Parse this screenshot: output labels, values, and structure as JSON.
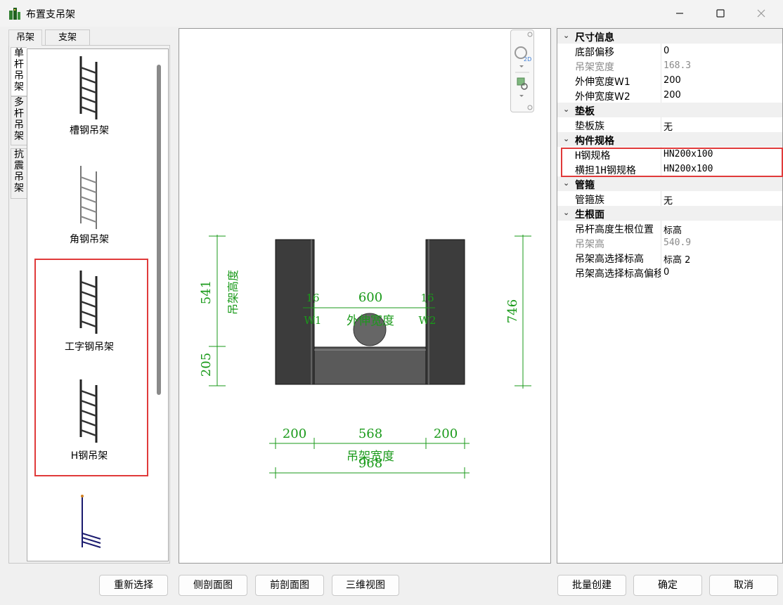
{
  "window": {
    "title": "布置支吊架",
    "icon": "building-icon",
    "controls": [
      "minimize-icon",
      "maximize-icon",
      "close-icon"
    ]
  },
  "left_tabs": {
    "top": [
      {
        "label": "吊架",
        "active": true
      },
      {
        "label": "支架",
        "active": false
      }
    ],
    "side": [
      {
        "label": "单杆吊架",
        "active": true
      },
      {
        "label": "多杆吊架",
        "active": false
      },
      {
        "label": "抗震吊架",
        "active": false
      }
    ]
  },
  "hanger_list": [
    {
      "label": "槽钢吊架",
      "icon": "channel-steel-hanger-icon"
    },
    {
      "label": "角钢吊架",
      "icon": "angle-steel-hanger-icon"
    },
    {
      "label": "工字钢吊架",
      "icon": "i-beam-hanger-icon"
    },
    {
      "label": "H钢吊架",
      "icon": "h-steel-hanger-icon"
    },
    {
      "label": "",
      "icon": "cantilever-hanger-icon"
    }
  ],
  "preview": {
    "dims": {
      "left_upper": "541",
      "left_upper_label": "吊架高度",
      "left_lower": "205",
      "right_height": "746",
      "top_left_flange": "16",
      "top_right_flange": "16",
      "top_mid": "600",
      "w1": "W1",
      "w2": "W2",
      "mid_label": "外伸宽度",
      "bottom_left": "200",
      "bottom_mid": "568",
      "bottom_right": "200",
      "bottom_label": "吊架宽度",
      "bottom_total": "968"
    },
    "toolbar": [
      "2d-view-icon",
      "zoom-region-icon"
    ]
  },
  "properties": {
    "categories": [
      {
        "name": "尺寸信息",
        "rows": [
          {
            "name": "底部偏移",
            "value": "0",
            "readonly": false
          },
          {
            "name": "吊架宽度",
            "value": "168.3",
            "readonly": true
          },
          {
            "name": "外伸宽度W1",
            "value": "200",
            "readonly": false
          },
          {
            "name": "外伸宽度W2",
            "value": "200",
            "readonly": false
          }
        ]
      },
      {
        "name": "垫板",
        "rows": [
          {
            "name": "垫板族",
            "value": "无",
            "readonly": false
          }
        ]
      },
      {
        "name": "构件规格",
        "rows": [
          {
            "name": "H钢规格",
            "value": "HN200x100",
            "readonly": false
          },
          {
            "name": "横担1H钢规格",
            "value": "HN200x100",
            "readonly": false
          }
        ]
      },
      {
        "name": "管箍",
        "rows": [
          {
            "name": "管箍族",
            "value": "无",
            "readonly": false
          }
        ]
      },
      {
        "name": "生根面",
        "rows": [
          {
            "name": "吊杆高度生根位置",
            "value": "标高",
            "readonly": false
          },
          {
            "name": "吊架高",
            "value": "540.9",
            "readonly": true
          },
          {
            "name": "吊架高选择标高",
            "value": "标高 2",
            "readonly": false
          },
          {
            "name": "吊架高选择标高偏移",
            "value": "0",
            "readonly": false
          }
        ]
      }
    ]
  },
  "buttons": {
    "reselect": "重新选择",
    "side_section": "侧剖面图",
    "front_section": "前剖面图",
    "view_3d": "三维视图",
    "batch_create": "批量创建",
    "ok": "确定",
    "cancel": "取消"
  },
  "colors": {
    "dimension_green": "#1a9a1a",
    "highlight_red": "#e03a3a",
    "steel_dark": "#3c3c3c"
  }
}
